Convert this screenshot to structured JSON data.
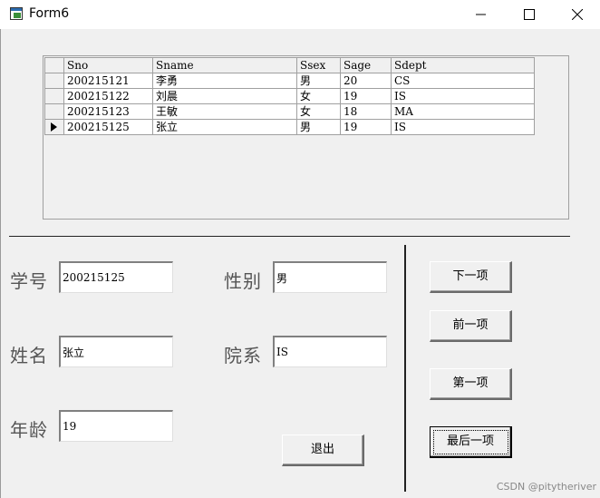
{
  "window": {
    "title": "Form6",
    "buttons": [
      "minimize",
      "maximize",
      "close"
    ]
  },
  "grid": {
    "columns": [
      "Sno",
      "Sname",
      "Ssex",
      "Sage",
      "Sdept"
    ],
    "rows": [
      {
        "Sno": "200215121",
        "Sname": "李勇",
        "Ssex": "男",
        "Sage": "20",
        "Sdept": "CS"
      },
      {
        "Sno": "200215122",
        "Sname": "刘晨",
        "Ssex": "女",
        "Sage": "19",
        "Sdept": "IS"
      },
      {
        "Sno": "200215123",
        "Sname": "王敏",
        "Ssex": "女",
        "Sage": "18",
        "Sdept": "MA"
      },
      {
        "Sno": "200215125",
        "Sname": "张立",
        "Ssex": "男",
        "Sage": "19",
        "Sdept": "IS"
      }
    ],
    "current_row_indicator": "▶"
  },
  "form": {
    "sno_label": "学号",
    "sno_value": "200215125",
    "sname_label": "姓名",
    "sname_value": "张立",
    "sage_label": "年龄",
    "sage_value": "19",
    "ssex_label": "性别",
    "ssex_value": "男",
    "sdept_label": "院系",
    "sdept_value": "IS"
  },
  "buttons": {
    "next": "下一项",
    "prev": "前一项",
    "first": "第一项",
    "last": "最后一项",
    "exit": "退出"
  },
  "watermark": "CSDN @pitytheriver",
  "colors": {
    "titlebar": "#ffffff",
    "client": "#f0f0f0",
    "cell": "#ffffff",
    "grid_border": "#a0a0a0"
  }
}
